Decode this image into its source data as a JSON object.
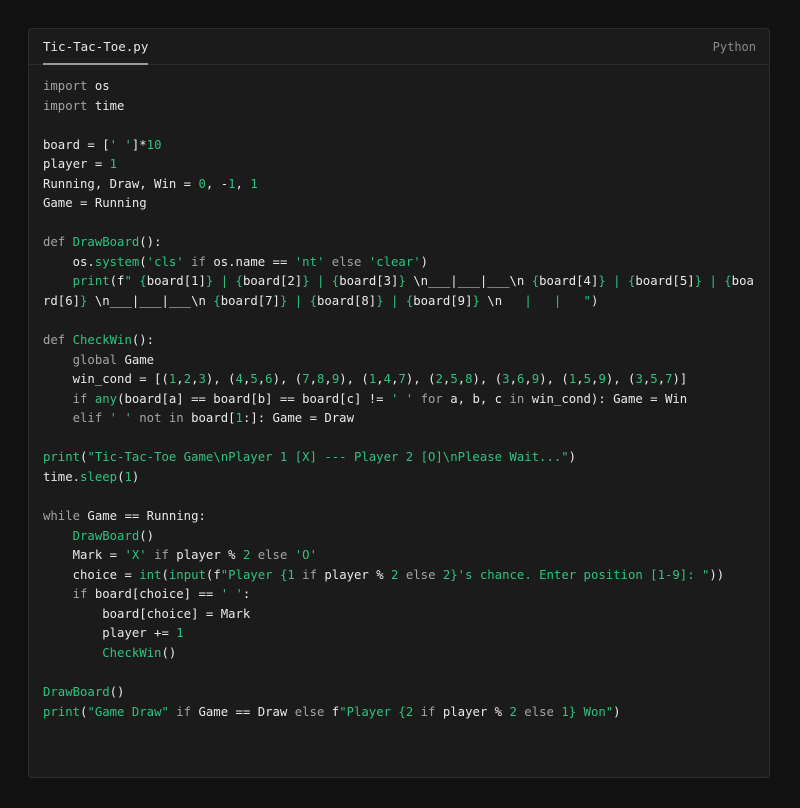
{
  "file": {
    "name": "Tic-Tac-Toe.py",
    "language": "Python"
  },
  "theme": {
    "background": "#111111",
    "panel": "#1b1b1b",
    "keyword": "#a3a3a3",
    "accent": "#2ec27e",
    "text": "#e8e8e8"
  },
  "code": [
    [
      [
        "kw",
        "import"
      ],
      [
        "pl",
        " os"
      ]
    ],
    [
      [
        "kw",
        "import"
      ],
      [
        "pl",
        " time"
      ]
    ],
    [],
    [
      [
        "pl",
        "board = ["
      ],
      [
        "st",
        "' '"
      ],
      [
        "pl",
        "]*"
      ],
      [
        "nm",
        "10"
      ]
    ],
    [
      [
        "pl",
        "player = "
      ],
      [
        "nm",
        "1"
      ]
    ],
    [
      [
        "pl",
        "Running, Draw, Win = "
      ],
      [
        "nm",
        "0"
      ],
      [
        "pl",
        ", -"
      ],
      [
        "nm",
        "1"
      ],
      [
        "pl",
        ", "
      ],
      [
        "nm",
        "1"
      ]
    ],
    [
      [
        "pl",
        "Game = Running"
      ]
    ],
    [],
    [
      [
        "kw",
        "def "
      ],
      [
        "fn",
        "DrawBoard"
      ],
      [
        "pl",
        "():"
      ]
    ],
    [
      [
        "pl",
        "    os."
      ],
      [
        "fn",
        "system"
      ],
      [
        "pl",
        "("
      ],
      [
        "st",
        "'cls'"
      ],
      [
        "kw",
        " if "
      ],
      [
        "pl",
        "os.name == "
      ],
      [
        "st",
        "'nt'"
      ],
      [
        "kw",
        " else "
      ],
      [
        "st",
        "'clear'"
      ],
      [
        "pl",
        ")"
      ]
    ],
    [
      [
        "pl",
        "    "
      ],
      [
        "fn",
        "print"
      ],
      [
        "pl",
        "(f"
      ],
      [
        "st",
        "\" {"
      ],
      [
        "pl",
        "board[1]"
      ],
      [
        "st",
        "} | {"
      ],
      [
        "pl",
        "board[2]"
      ],
      [
        "st",
        "} | {"
      ],
      [
        "pl",
        "board[3]"
      ],
      [
        "st",
        "} "
      ],
      [
        "pl",
        "\\n___|___|___\\n"
      ],
      [
        "st",
        " {"
      ],
      [
        "pl",
        "board[4]"
      ],
      [
        "st",
        "} | {"
      ],
      [
        "pl",
        "board[5]"
      ],
      [
        "st",
        "} | {"
      ],
      [
        "pl",
        "board[6]"
      ],
      [
        "st",
        "} "
      ],
      [
        "pl",
        "\\n___|___|___\\n"
      ],
      [
        "st",
        " {"
      ],
      [
        "pl",
        "board[7]"
      ],
      [
        "st",
        "} | {"
      ],
      [
        "pl",
        "board[8]"
      ],
      [
        "st",
        "} | {"
      ],
      [
        "pl",
        "board[9]"
      ],
      [
        "st",
        "} "
      ],
      [
        "pl",
        "\\n"
      ],
      [
        "st",
        "   |   |   \""
      ],
      [
        "pl",
        ")"
      ]
    ],
    [],
    [
      [
        "kw",
        "def "
      ],
      [
        "fn",
        "CheckWin"
      ],
      [
        "pl",
        "():"
      ]
    ],
    [
      [
        "kw",
        "    global"
      ],
      [
        "pl",
        " Game"
      ]
    ],
    [
      [
        "pl",
        "    win_cond = [("
      ],
      [
        "nm",
        "1"
      ],
      [
        "pl",
        ","
      ],
      [
        "nm",
        "2"
      ],
      [
        "pl",
        ","
      ],
      [
        "nm",
        "3"
      ],
      [
        "pl",
        "), ("
      ],
      [
        "nm",
        "4"
      ],
      [
        "pl",
        ","
      ],
      [
        "nm",
        "5"
      ],
      [
        "pl",
        ","
      ],
      [
        "nm",
        "6"
      ],
      [
        "pl",
        "), ("
      ],
      [
        "nm",
        "7"
      ],
      [
        "pl",
        ","
      ],
      [
        "nm",
        "8"
      ],
      [
        "pl",
        ","
      ],
      [
        "nm",
        "9"
      ],
      [
        "pl",
        "), ("
      ],
      [
        "nm",
        "1"
      ],
      [
        "pl",
        ","
      ],
      [
        "nm",
        "4"
      ],
      [
        "pl",
        ","
      ],
      [
        "nm",
        "7"
      ],
      [
        "pl",
        "), ("
      ],
      [
        "nm",
        "2"
      ],
      [
        "pl",
        ","
      ],
      [
        "nm",
        "5"
      ],
      [
        "pl",
        ","
      ],
      [
        "nm",
        "8"
      ],
      [
        "pl",
        "), ("
      ],
      [
        "nm",
        "3"
      ],
      [
        "pl",
        ","
      ],
      [
        "nm",
        "6"
      ],
      [
        "pl",
        ","
      ],
      [
        "nm",
        "9"
      ],
      [
        "pl",
        "), ("
      ],
      [
        "nm",
        "1"
      ],
      [
        "pl",
        ","
      ],
      [
        "nm",
        "5"
      ],
      [
        "pl",
        ","
      ],
      [
        "nm",
        "9"
      ],
      [
        "pl",
        "), ("
      ],
      [
        "nm",
        "3"
      ],
      [
        "pl",
        ","
      ],
      [
        "nm",
        "5"
      ],
      [
        "pl",
        ","
      ],
      [
        "nm",
        "7"
      ],
      [
        "pl",
        ")]"
      ]
    ],
    [
      [
        "kw",
        "    if "
      ],
      [
        "fn",
        "any"
      ],
      [
        "pl",
        "(board[a] == board[b] == board[c] != "
      ],
      [
        "st",
        "' '"
      ],
      [
        "kw",
        " for "
      ],
      [
        "pl",
        "a, b, c "
      ],
      [
        "kw",
        "in "
      ],
      [
        "pl",
        "win_cond): Game = Win"
      ]
    ],
    [
      [
        "kw",
        "    elif "
      ],
      [
        "st",
        "' '"
      ],
      [
        "kw",
        " not in "
      ],
      [
        "pl",
        "board["
      ],
      [
        "nm",
        "1"
      ],
      [
        "pl",
        ":]: Game = Draw"
      ]
    ],
    [],
    [
      [
        "fn",
        "print"
      ],
      [
        "pl",
        "("
      ],
      [
        "st",
        "\"Tic-Tac-Toe Game\\nPlayer 1 [X] --- Player 2 [O]\\nPlease Wait...\""
      ],
      [
        "pl",
        ")"
      ]
    ],
    [
      [
        "pl",
        "time."
      ],
      [
        "fn",
        "sleep"
      ],
      [
        "pl",
        "("
      ],
      [
        "nm",
        "1"
      ],
      [
        "pl",
        ")"
      ]
    ],
    [],
    [
      [
        "kw",
        "while "
      ],
      [
        "pl",
        "Game == Running:"
      ]
    ],
    [
      [
        "pl",
        "    "
      ],
      [
        "fn",
        "DrawBoard"
      ],
      [
        "pl",
        "()"
      ]
    ],
    [
      [
        "pl",
        "    Mark = "
      ],
      [
        "st",
        "'X'"
      ],
      [
        "kw",
        " if "
      ],
      [
        "pl",
        "player % "
      ],
      [
        "nm",
        "2"
      ],
      [
        "kw",
        " else "
      ],
      [
        "st",
        "'O'"
      ]
    ],
    [
      [
        "pl",
        "    choice = "
      ],
      [
        "fn",
        "int"
      ],
      [
        "pl",
        "("
      ],
      [
        "fn",
        "input"
      ],
      [
        "pl",
        "(f"
      ],
      [
        "st",
        "\"Player {"
      ],
      [
        "nm",
        "1"
      ],
      [
        "kw",
        " if "
      ],
      [
        "pl",
        "player % "
      ],
      [
        "nm",
        "2"
      ],
      [
        "kw",
        " else "
      ],
      [
        "nm",
        "2"
      ],
      [
        "st",
        "}'s chance. Enter position [1-9]: \""
      ],
      [
        "pl",
        "))"
      ]
    ],
    [
      [
        "kw",
        "    if "
      ],
      [
        "pl",
        "board[choice] == "
      ],
      [
        "st",
        "' '"
      ],
      [
        "pl",
        ":"
      ]
    ],
    [
      [
        "pl",
        "        board[choice] = Mark"
      ]
    ],
    [
      [
        "pl",
        "        player += "
      ],
      [
        "nm",
        "1"
      ]
    ],
    [
      [
        "pl",
        "        "
      ],
      [
        "fn",
        "CheckWin"
      ],
      [
        "pl",
        "()"
      ]
    ],
    [],
    [
      [
        "fn",
        "DrawBoard"
      ],
      [
        "pl",
        "()"
      ]
    ],
    [
      [
        "fn",
        "print"
      ],
      [
        "pl",
        "("
      ],
      [
        "st",
        "\"Game Draw\""
      ],
      [
        "kw",
        " if "
      ],
      [
        "pl",
        "Game == Draw "
      ],
      [
        "kw",
        "else "
      ],
      [
        "pl",
        "f"
      ],
      [
        "st",
        "\"Player {"
      ],
      [
        "nm",
        "2"
      ],
      [
        "kw",
        " if "
      ],
      [
        "pl",
        "player % "
      ],
      [
        "nm",
        "2"
      ],
      [
        "kw",
        " else "
      ],
      [
        "nm",
        "1"
      ],
      [
        "st",
        "} Won\""
      ],
      [
        "pl",
        ")"
      ]
    ]
  ]
}
